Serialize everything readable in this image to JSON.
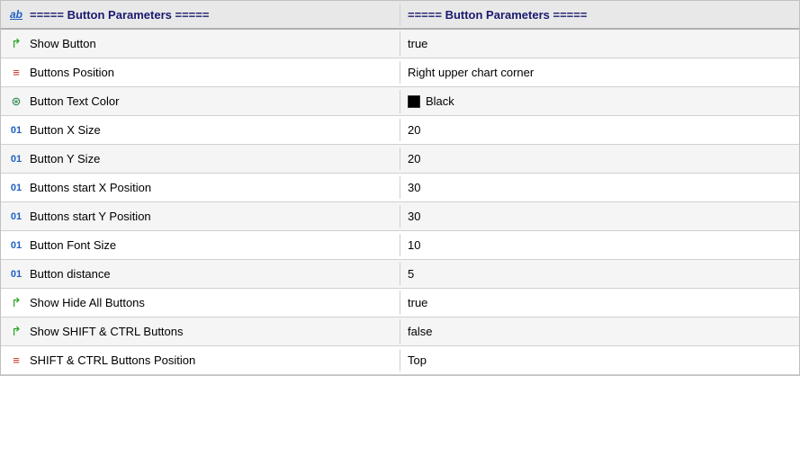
{
  "table": {
    "header": {
      "left_label": "===== Button Parameters =====",
      "right_label": "===== Button Parameters =====",
      "left_icon": "ab"
    },
    "rows": [
      {
        "icon_type": "arrow",
        "icon_symbol": "↱",
        "label": "Show Button",
        "value": "true"
      },
      {
        "icon_type": "lines",
        "icon_symbol": "≡",
        "label": "Buttons Position",
        "value": "Right upper chart corner"
      },
      {
        "icon_type": "circle",
        "icon_symbol": "⊛",
        "label": "Button Text Color",
        "value": "Black",
        "has_swatch": true,
        "swatch_color": "#000000"
      },
      {
        "icon_type": "num",
        "icon_symbol": "01",
        "label": "Button X Size",
        "value": "20"
      },
      {
        "icon_type": "num",
        "icon_symbol": "01",
        "label": "Button Y Size",
        "value": "20"
      },
      {
        "icon_type": "num",
        "icon_symbol": "01",
        "label": "Buttons start X Position",
        "value": "30"
      },
      {
        "icon_type": "num",
        "icon_symbol": "01",
        "label": "Buttons start Y Position",
        "value": "30"
      },
      {
        "icon_type": "num",
        "icon_symbol": "01",
        "label": "Button Font Size",
        "value": "10"
      },
      {
        "icon_type": "num",
        "icon_symbol": "01",
        "label": "Button distance",
        "value": "5"
      },
      {
        "icon_type": "arrow",
        "icon_symbol": "↱",
        "label": "Show Hide All Buttons",
        "value": "true"
      },
      {
        "icon_type": "arrow",
        "icon_symbol": "↱",
        "label": "Show SHIFT & CTRL Buttons",
        "value": "false"
      },
      {
        "icon_type": "lines",
        "icon_symbol": "≡",
        "label": "SHIFT & CTRL Buttons Position",
        "value": "Top"
      }
    ]
  }
}
